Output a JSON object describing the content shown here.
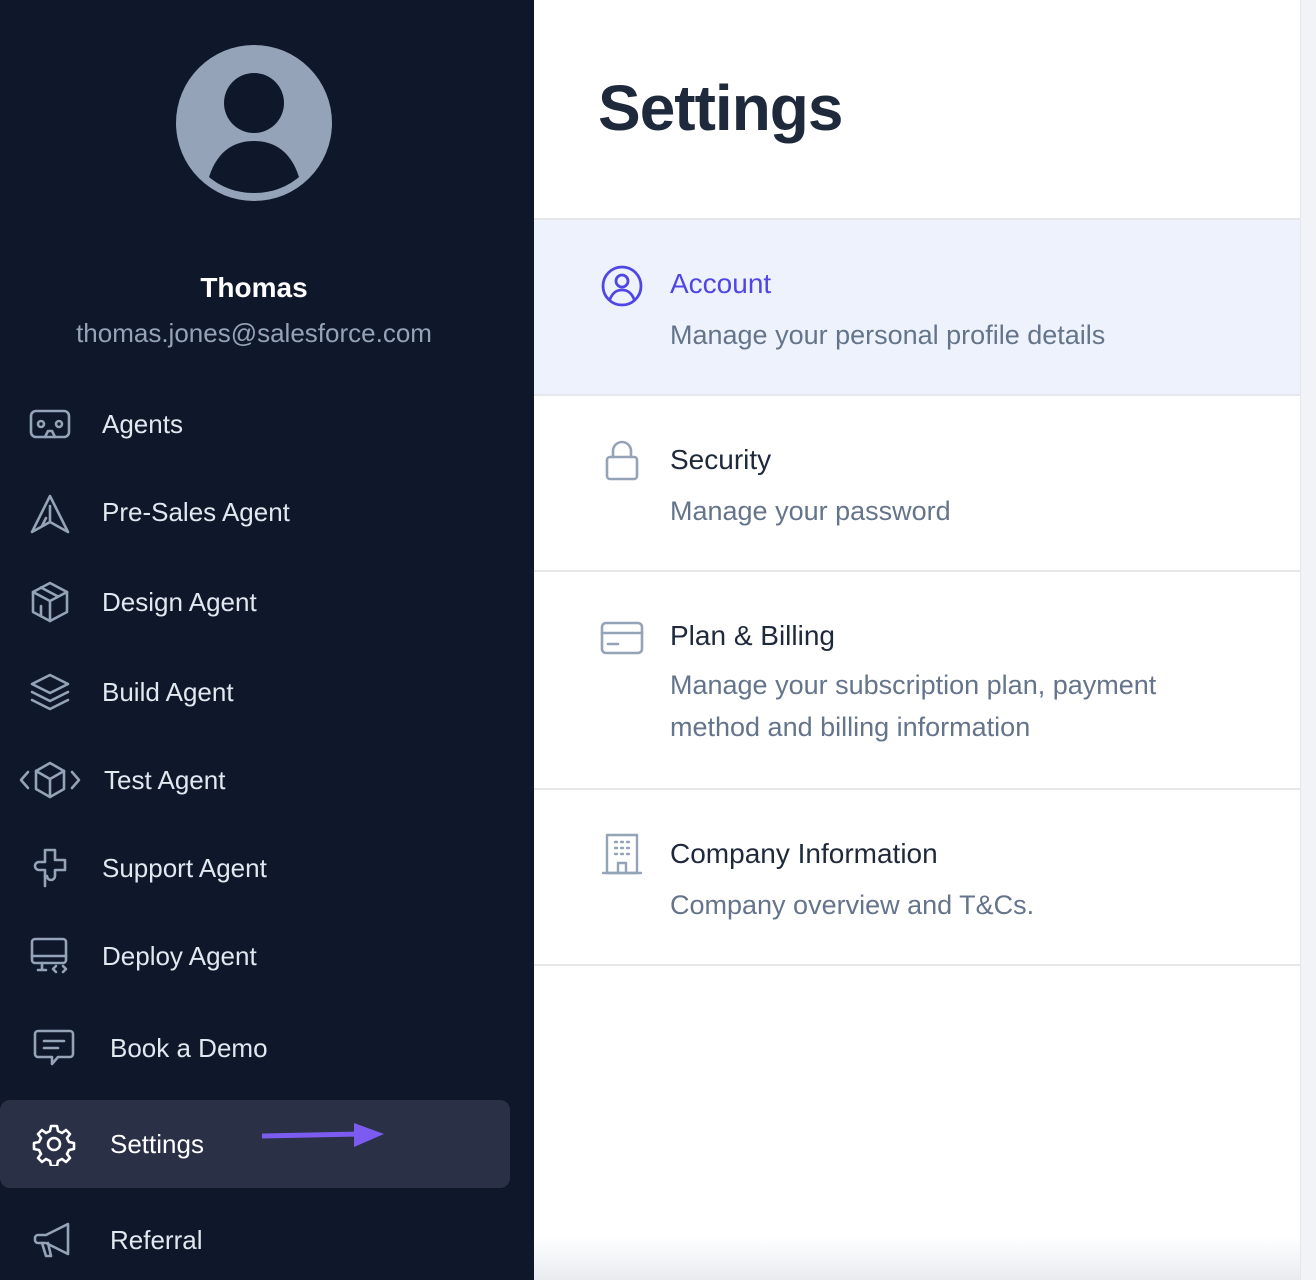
{
  "sidebar": {
    "user": {
      "name": "Thomas",
      "email": "thomas.jones@salesforce.com"
    },
    "items": [
      {
        "label": "Agents",
        "icon": "vr-headset-icon",
        "active": false
      },
      {
        "label": "Pre-Sales Agent",
        "icon": "paper-plane-icon",
        "active": false
      },
      {
        "label": "Design Agent",
        "icon": "cube-icon",
        "active": false
      },
      {
        "label": "Build Agent",
        "icon": "layers-icon",
        "active": false
      },
      {
        "label": "Test Agent",
        "icon": "code-cube-icon",
        "active": false
      },
      {
        "label": "Support Agent",
        "icon": "puzzle-icon",
        "active": false
      },
      {
        "label": "Deploy Agent",
        "icon": "monitor-code-icon",
        "active": false
      },
      {
        "label": "Book a Demo",
        "icon": "chat-bubble-icon",
        "active": false
      },
      {
        "label": "Settings",
        "icon": "gear-icon",
        "active": true
      },
      {
        "label": "Referral",
        "icon": "megaphone-icon",
        "active": false
      }
    ],
    "colors": {
      "background": "#0f172a",
      "active_bg": "#2a3045",
      "arrow": "#7c5cf0"
    }
  },
  "main": {
    "title": "Settings",
    "sections": [
      {
        "title": "Account",
        "description": "Manage your personal profile details",
        "icon": "user-circle-icon",
        "selected": true
      },
      {
        "title": "Security",
        "description": "Manage your password",
        "icon": "lock-icon",
        "selected": false
      },
      {
        "title": "Plan & Billing",
        "description": "Manage your subscription plan, payment method and billing information",
        "icon": "credit-card-icon",
        "selected": false
      },
      {
        "title": "Company Information",
        "description": "Company overview and T&Cs.",
        "icon": "building-icon",
        "selected": false
      }
    ],
    "colors": {
      "selected_bg": "#eef2fc",
      "accent": "#4f46e5"
    }
  }
}
